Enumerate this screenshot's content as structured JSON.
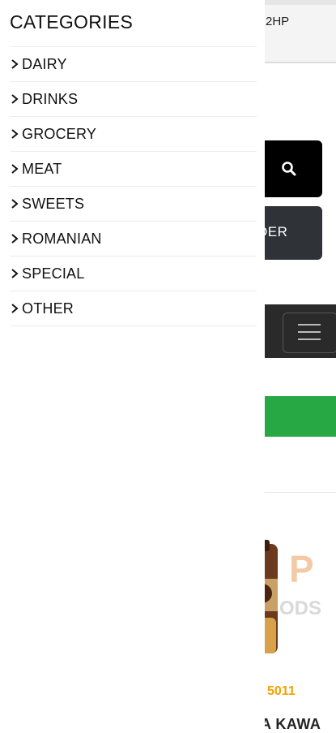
{
  "drawer": {
    "title": "CATEGORIES",
    "items": [
      {
        "label": "DAIRY"
      },
      {
        "label": "DRINKS"
      },
      {
        "label": "GROCERY"
      },
      {
        "label": "MEAT"
      },
      {
        "label": "SWEETS"
      },
      {
        "label": "ROMANIAN"
      },
      {
        "label": "SPECIAL"
      },
      {
        "label": "OTHER"
      }
    ]
  },
  "background": {
    "header_text": "2HP",
    "order_button_label": "DER",
    "product_code": "5011",
    "product_name": "A KAWA",
    "logo_text": "ODS"
  },
  "colors": {
    "search_button": "#000000",
    "order_button": "#2f3337",
    "navbar": "#2a2a2a",
    "green_bar": "#28a745",
    "product_code": "#f4a100"
  }
}
